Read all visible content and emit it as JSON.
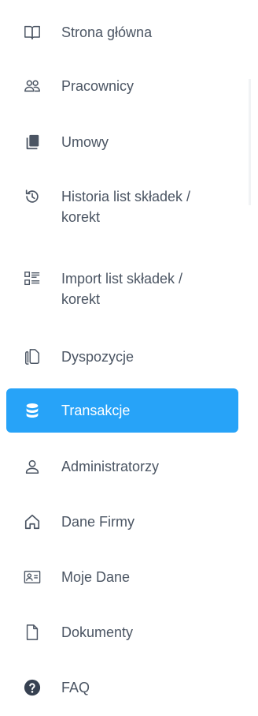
{
  "sidebar": {
    "items": [
      {
        "label": "Strona główna",
        "icon": "book-open-icon"
      },
      {
        "label": "Pracownicy",
        "icon": "users-icon"
      },
      {
        "label": "Umowy",
        "icon": "books-icon"
      },
      {
        "label": "Historia list składek /\nkorekt",
        "icon": "history-icon"
      },
      {
        "label": "Import list składek /\nkorekt",
        "icon": "list-import-icon"
      },
      {
        "label": "Dyspozycje",
        "icon": "documents-icon"
      },
      {
        "label": "Transakcje",
        "icon": "database-icon",
        "active": true
      },
      {
        "label": "Administratorzy",
        "icon": "user-icon"
      },
      {
        "label": "Dane Firmy",
        "icon": "home-icon"
      },
      {
        "label": "Moje Dane",
        "icon": "id-card-icon"
      },
      {
        "label": "Dokumenty",
        "icon": "file-icon"
      },
      {
        "label": "FAQ",
        "icon": "question-circle-icon"
      }
    ]
  },
  "colors": {
    "accent": "#27a3f8",
    "text": "#4b5563",
    "active_text": "#ffffff"
  }
}
